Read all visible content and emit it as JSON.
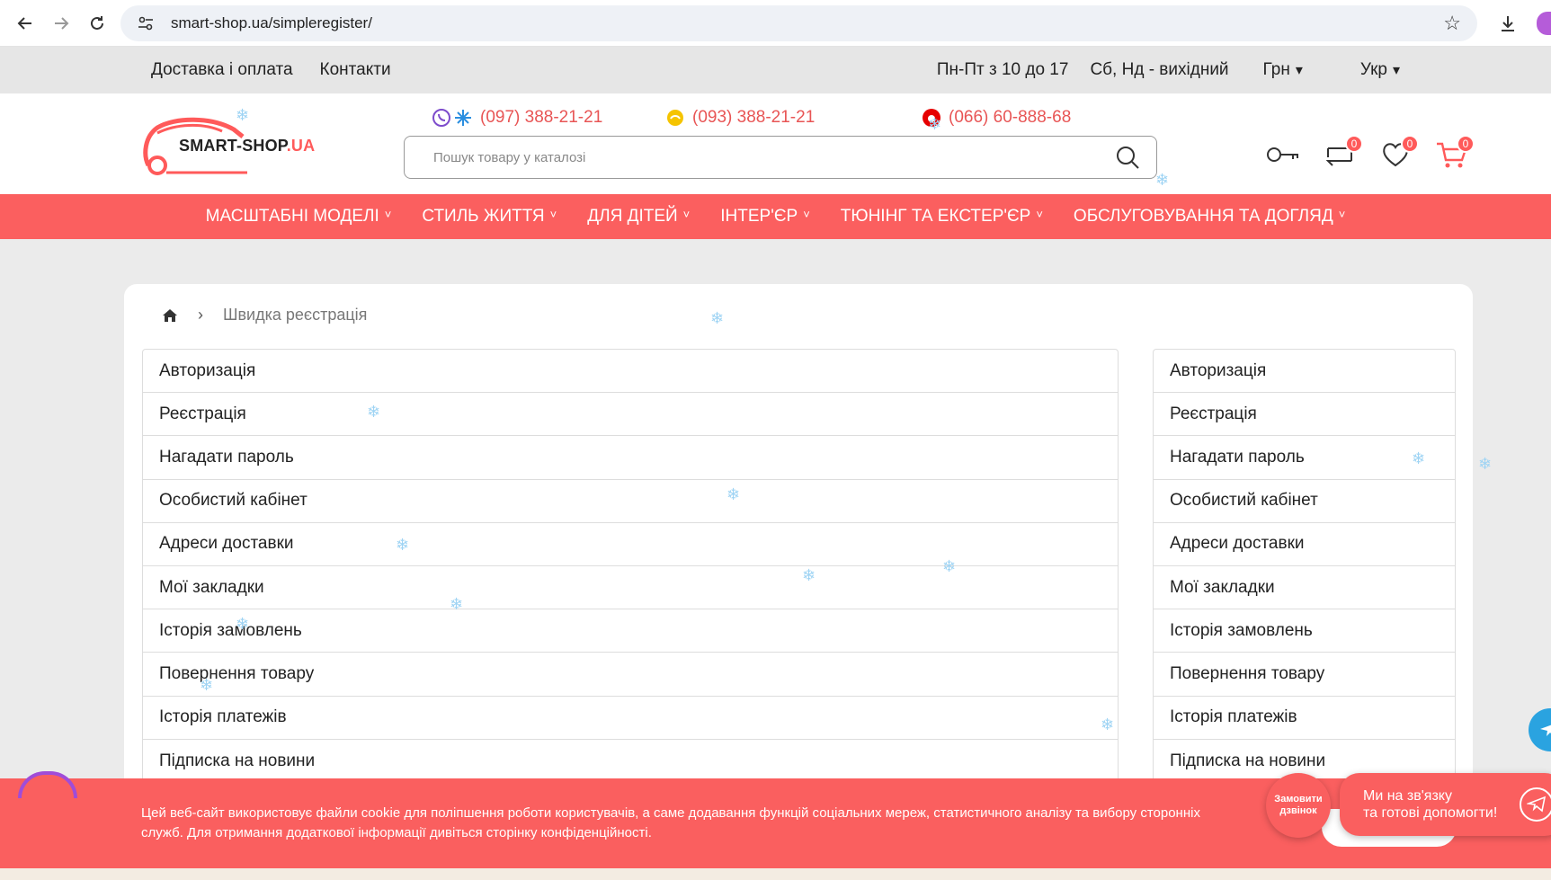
{
  "browser": {
    "url": "smart-shop.ua/simpleregister/"
  },
  "topbar": {
    "links": [
      "Доставка і оплата",
      "Контакти"
    ],
    "schedule_weekdays": "Пн-Пт з 10 до 17",
    "schedule_weekend": "Сб, Нд - вихідний",
    "currency": "Грн",
    "language": "Укр"
  },
  "header": {
    "logo_text_main": "SMART-SHOP",
    "logo_text_ua": ".UA",
    "phones": [
      "(097) 388-21-21",
      "(093) 388-21-21",
      "(066) 60-888-68"
    ],
    "search_placeholder": "Пошук товару у каталозі",
    "compare_count": "0",
    "wishlist_count": "0",
    "cart_count": "0"
  },
  "menu": {
    "items": [
      "Масштабні моделі",
      "Стиль життя",
      "Для дітей",
      "Інтер'єр",
      "Тюнінг та екстер'єр",
      "Обслуговування та догляд"
    ]
  },
  "breadcrumb": {
    "current": "Швидка реєстрація"
  },
  "account_menu": {
    "items": [
      "Авторизація",
      "Реєстрація",
      "Нагадати пароль",
      "Особистий кабінет",
      "Адреси доставки",
      "Мої закладки",
      "Історія замовлень",
      "Повернення товару",
      "Історія платежів",
      "Підписка на новини"
    ]
  },
  "cookie": {
    "text": "Цей веб-сайт використовує файли cookie для поліпшення роботи користувачів, а саме додавання функцій соціальних мереж, статистичного аналізу та вибору сторонніх служб. Для отримання додаткової інформації дивіться сторінку конфіденційності."
  },
  "widgets": {
    "callback_label": "Замовити дзвінок",
    "chat_line1": "Ми на зв'язку",
    "chat_line2": "та готові допомогти!"
  },
  "colors": {
    "accent": "#fb5f5f",
    "phone_text": "#e85555",
    "telegram": "#2aa3e0"
  }
}
